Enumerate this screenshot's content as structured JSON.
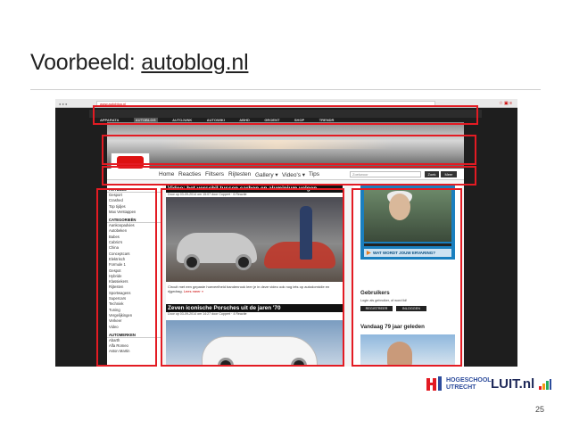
{
  "slide": {
    "title_prefix": "Voorbeeld: ",
    "title_link": "autoblog.nl",
    "page_number": "25"
  },
  "browser": {
    "url": "www.autoblog.nl"
  },
  "site": {
    "top_nav": [
      "APPARATA",
      "AUTOBLOG",
      "AUTOJUNK",
      "AUTOWIKI",
      "ABHD",
      "GROENT",
      "SHOP",
      "TRENDR"
    ],
    "top_nav_active": "AUTOBLOG",
    "logo_text": "AUTOBLOG.NL",
    "main_nav": [
      "Home",
      "Reacties",
      "Filtsers",
      "Rijtesten",
      "Gallery ▾",
      "Video's ▾",
      "Tips"
    ],
    "search_placeholder": "Zoekwoor",
    "search_button": "Zoek",
    "more_button": "Meer",
    "sidebar": {
      "heading_actueel": "ACTUEEL",
      "actueel_items": [
        "Gesport",
        "Crashed",
        "Top tijdjes",
        "Max Verstappen"
      ],
      "heading_categorieen": "CATEGORIEËN",
      "category_items": [
        "Aankoopadvies",
        "Autobeken",
        "Babes",
        "Cabrio's",
        "China",
        "Conceptcars",
        "Elektrisch",
        "Formule 1",
        "Gespot",
        "Hybride",
        "Klassiekers",
        "Rijtesten",
        "Sportwagens",
        "Supercars",
        "Techniek",
        "Tuning",
        "Vergelijkingen",
        "Verkeer",
        "Video"
      ],
      "heading_automerken": "AUTOMERKEN",
      "automerken_items": [
        "Abarth",
        "Alfa Romeo",
        "Aston Martin"
      ]
    },
    "articles": [
      {
        "title": "Video: het verschil tussen carbon en aluminium velgen",
        "meta": "Door op 03-09-2014 om 15:07 door Coppert · 6 Reactie",
        "excerpt": "Circuit met een gepaste hoeveelheid bandenrook leer je in deze video ook nog iets op autodomicile en rijgedrag.",
        "more": "Lees meer »"
      },
      {
        "title": "Zeven iconische Porsches uit de jaren '70",
        "meta": "Door op 03-09-2014 om 14:27 door Coppert · 4 Reactie",
        "excerpt": "",
        "more": ""
      }
    ],
    "ad": {
      "cta": "WAT WORDT JOUW ERVARING?"
    },
    "users": {
      "heading": "Gebruikers",
      "text": "Login als gebruiker, of word lid!",
      "register": "REGISTREER",
      "login": "INLOGGEN"
    },
    "today": {
      "heading": "Vandaag 79 jaar geleden"
    }
  },
  "logos": {
    "hu_line1": "HOGESCHOOL",
    "hu_line2": "UTRECHT",
    "luit": "LUIT.nl"
  },
  "colors": {
    "highlight": "#e31b23",
    "accent": "#c00000"
  }
}
